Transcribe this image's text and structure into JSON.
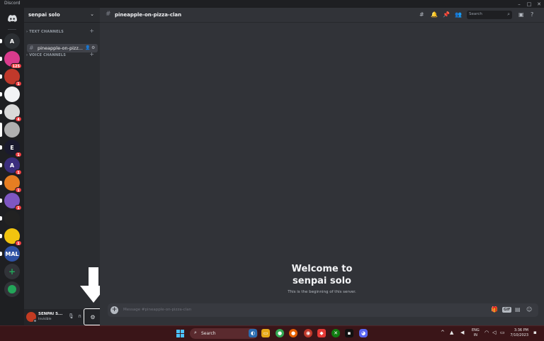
{
  "window": {
    "title": "Discord"
  },
  "server": {
    "name": "senpai solo"
  },
  "servers": [
    {
      "label": "",
      "color": "#5865f2",
      "badge": ""
    },
    {
      "label": "A",
      "color": "#2c2f33",
      "badge": ""
    },
    {
      "label": "",
      "color": "#d93b8c",
      "badge": "125"
    },
    {
      "label": "",
      "color": "#c0392b",
      "badge": "1"
    },
    {
      "label": "",
      "color": "#f2f3f5",
      "badge": ""
    },
    {
      "label": "",
      "color": "#d9d9d9",
      "badge": "4"
    },
    {
      "label": "",
      "color": "#b0b0b0",
      "badge": ""
    },
    {
      "label": "E",
      "color": "#1a1a2e",
      "badge": "1"
    },
    {
      "label": "A",
      "color": "#3b2e7e",
      "badge": "1"
    },
    {
      "label": "",
      "color": "#e67e22",
      "badge": "1"
    },
    {
      "label": "",
      "color": "#7e57c2",
      "badge": "1"
    },
    {
      "label": "",
      "color": "#222222",
      "badge": ""
    },
    {
      "label": "",
      "color": "#f1c40f",
      "badge": "1"
    },
    {
      "label": "MAL",
      "color": "#2e51a2",
      "badge": ""
    }
  ],
  "sidebar": {
    "text_channels_label": "TEXT CHANNELS",
    "voice_channels_label": "VOICE CHANNELS",
    "active_channel": "pineapple-on-pizz..."
  },
  "channel": {
    "name": "pineapple-on-pizza-clan",
    "search_placeholder": "Search",
    "welcome_line1": "Welcome to",
    "welcome_line2": "senpai solo",
    "welcome_sub": "This is the beginning of this server.",
    "message_placeholder": "Message #pineapple-on-pizza-clan",
    "gif_label": "GIF"
  },
  "user": {
    "name": "SENPAI S...",
    "status": "Invisible"
  },
  "taskbar": {
    "search_label": "Search",
    "lang_line1": "ENG",
    "lang_line2": "IN",
    "time": "3:36 PM",
    "date": "7/10/2023"
  },
  "colors": {
    "accent": "#5865f2",
    "rail_bg": "#1e1f22",
    "sidebar_bg": "#2b2d31",
    "main_bg": "#313338",
    "taskbar_bg": "#3a1518"
  }
}
